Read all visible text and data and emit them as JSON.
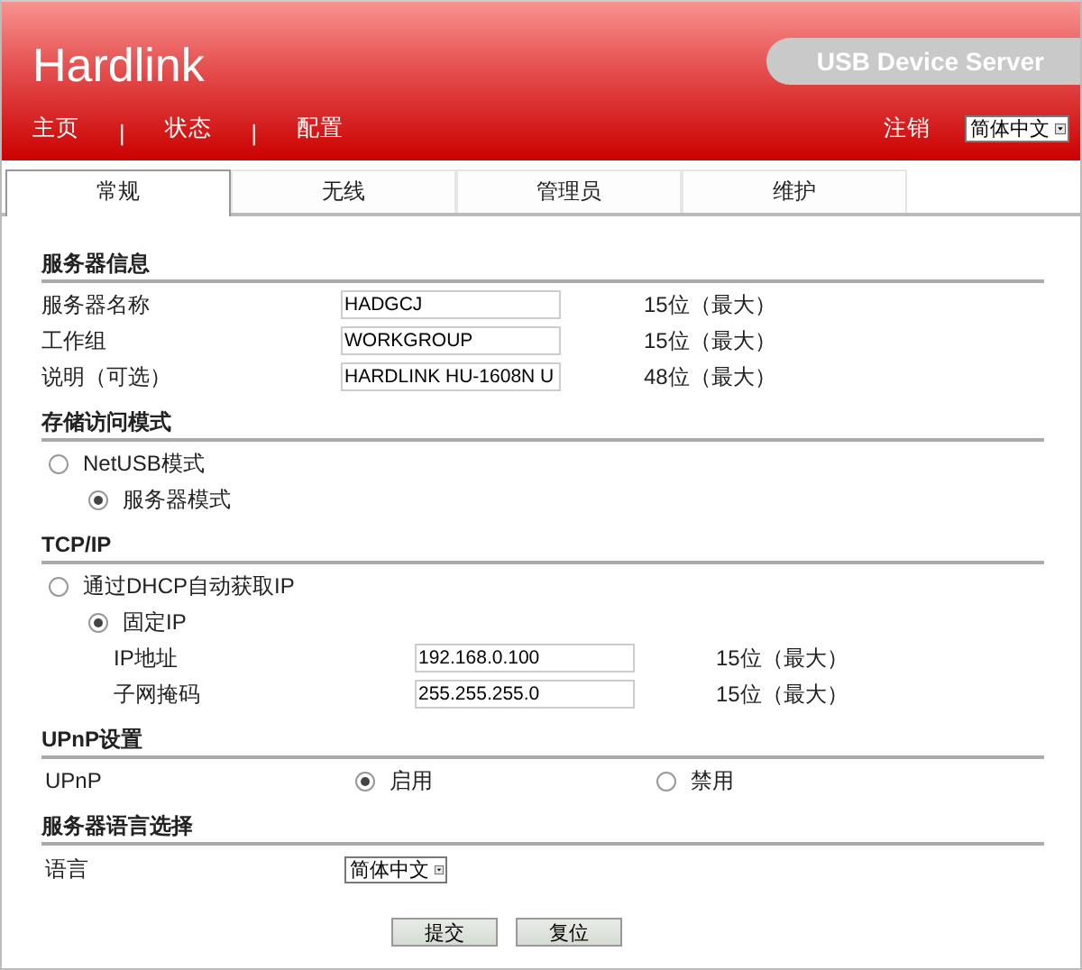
{
  "header": {
    "brand": "Hardlink",
    "product": "USB Device Server"
  },
  "nav": [
    {
      "kind": "link",
      "label": "主页"
    },
    {
      "kind": "separator",
      "label": "|"
    },
    {
      "kind": "link",
      "label": "状态"
    },
    {
      "kind": "separator",
      "label": "|"
    },
    {
      "kind": "link",
      "label": "配置"
    }
  ],
  "logout": "注销",
  "header_language": {
    "value": "简体中文"
  },
  "tabs": [
    {
      "label": "常规",
      "selected": true
    },
    {
      "label": "无线",
      "selected": false
    },
    {
      "label": "管理员",
      "selected": false
    },
    {
      "label": "维护",
      "selected": false
    }
  ],
  "sections": [
    {
      "title": "服务器信息",
      "rows": [
        {
          "kind": "field",
          "label": "服务器名称",
          "value": "HADGCJ",
          "hint": "15位（最大）"
        },
        {
          "kind": "field",
          "label": "工作组",
          "value": "WORKGROUP",
          "hint": "15位（最大）"
        },
        {
          "kind": "field",
          "label": "说明（可选）",
          "value": "HARDLINK HU-1608N U",
          "hint": "48位（最大）"
        }
      ]
    },
    {
      "title": "存储访问模式",
      "rows": [
        {
          "kind": "radio",
          "label": "NetUSB模式",
          "selected": false
        },
        {
          "kind": "subradio",
          "label": "服务器模式",
          "selected": true
        }
      ]
    },
    {
      "title": "TCP/IP",
      "rows": [
        {
          "kind": "radio",
          "label": "通过DHCP自动获取IP",
          "selected": false
        },
        {
          "kind": "subradio",
          "label": "固定IP",
          "selected": true
        },
        {
          "kind": "subfield",
          "label": "IP地址",
          "value": "192.168.0.100",
          "hint": "15位（最大）"
        },
        {
          "kind": "subfield",
          "label": "子网掩码",
          "value": "255.255.255.0",
          "hint": "15位（最大）"
        }
      ]
    },
    {
      "title": "UPnP设置",
      "rows": [
        {
          "kind": "choice",
          "label": "UPnP",
          "options": [
            {
              "label": "启用",
              "selected": true
            },
            {
              "label": "禁用",
              "selected": false
            }
          ]
        }
      ]
    },
    {
      "title": "服务器语言选择",
      "rows": [
        {
          "kind": "select",
          "label": "语言",
          "value": "简体中文"
        }
      ]
    }
  ],
  "buttons": [
    "提交",
    "复位"
  ]
}
